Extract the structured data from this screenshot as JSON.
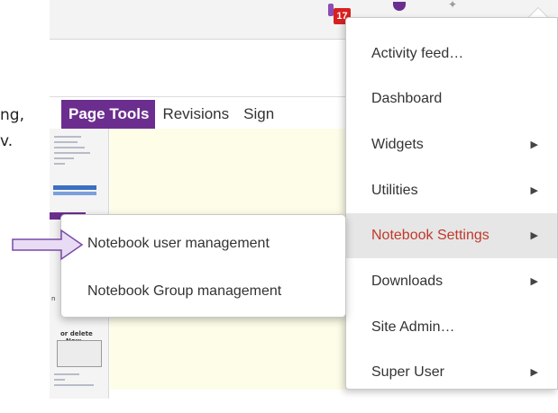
{
  "header": {
    "notification_count": "17"
  },
  "side_text": {
    "line1": "ng,",
    "line2": "v."
  },
  "tabs": [
    {
      "label": "Page Tools",
      "active": true
    },
    {
      "label": "Revisions",
      "active": false
    },
    {
      "label": "Sign",
      "active": false
    }
  ],
  "notebook_panel": {
    "tiny_a": "n",
    "tiny_b": "or delete",
    "tiny_c": "New"
  },
  "menu": {
    "items": [
      {
        "label": "Activity feed…",
        "has_submenu": false
      },
      {
        "label": "Dashboard",
        "has_submenu": false
      },
      {
        "label": "Widgets",
        "has_submenu": true
      },
      {
        "label": "Utilities",
        "has_submenu": true
      },
      {
        "label": "Notebook Settings",
        "has_submenu": true,
        "active": true
      },
      {
        "label": "Downloads",
        "has_submenu": true
      },
      {
        "label": "Site Admin…",
        "has_submenu": false
      },
      {
        "label": "Super User",
        "has_submenu": true
      }
    ],
    "submenu_arrow": "▶"
  },
  "submenu": {
    "items": [
      {
        "label": "Notebook user management"
      },
      {
        "label": "Notebook Group management"
      }
    ]
  },
  "colors": {
    "brand_purple": "#6b2e8f",
    "active_text": "#c0392b",
    "badge_red": "#d92020",
    "content_bg": "#fdfde8"
  }
}
